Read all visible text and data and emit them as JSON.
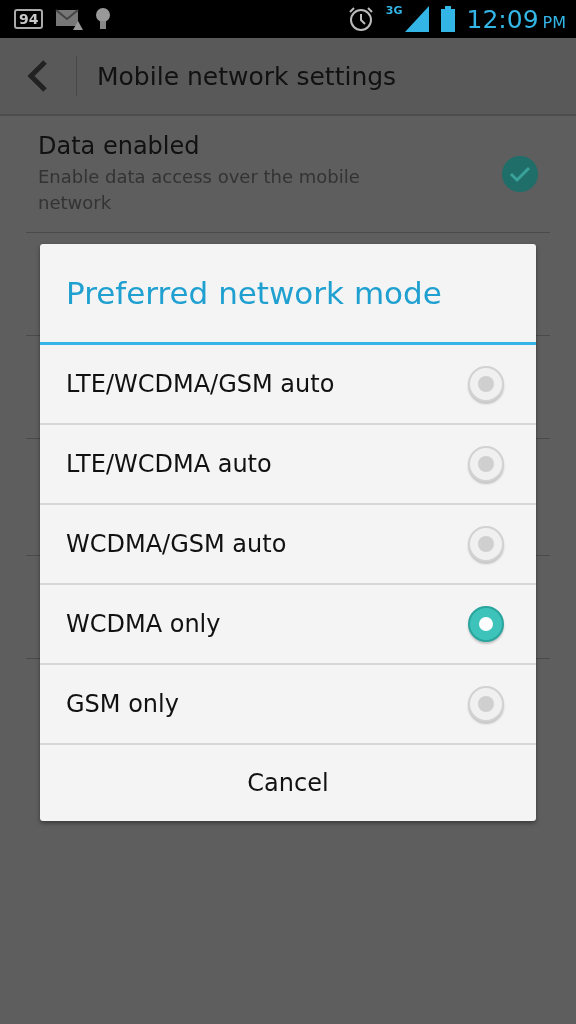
{
  "status_bar": {
    "notification_count": "94",
    "network_type": "3G",
    "time": "12:09",
    "time_suffix": "PM"
  },
  "action_bar": {
    "title": "Mobile network settings"
  },
  "settings": [
    {
      "title": "Data enabled",
      "summary": "Enable data access over the mobile network",
      "checked": true
    }
  ],
  "dialog": {
    "title": "Preferred network mode",
    "options": [
      {
        "label": "LTE/WCDMA/GSM auto",
        "selected": false
      },
      {
        "label": "LTE/WCDMA auto",
        "selected": false
      },
      {
        "label": "WCDMA/GSM auto",
        "selected": false
      },
      {
        "label": "WCDMA only",
        "selected": true
      },
      {
        "label": "GSM only",
        "selected": false
      }
    ],
    "cancel": "Cancel"
  }
}
